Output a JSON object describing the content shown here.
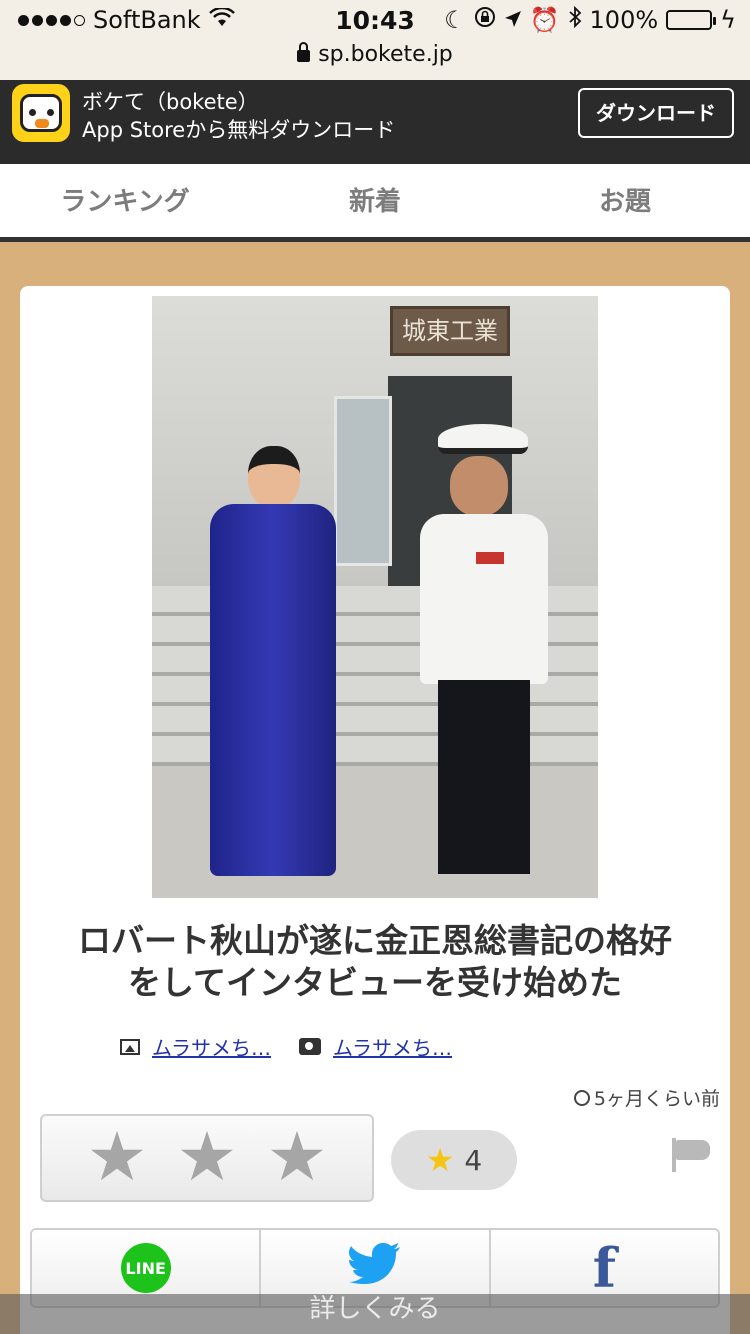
{
  "status_bar": {
    "carrier": "SoftBank",
    "time": "10:43",
    "battery": "100%"
  },
  "url_bar": {
    "domain": "sp.bokete.jp"
  },
  "app_banner": {
    "name": "ボケて（bokete）",
    "subtitle": "App Storeから無料ダウンロード",
    "download_label": "ダウンロード"
  },
  "tabs": [
    {
      "label": "ランキング"
    },
    {
      "label": "新着"
    },
    {
      "label": "お題"
    }
  ],
  "post": {
    "photo_sign_text": "城東工業",
    "caption_line1": "ロバート秋山が遂に金正恩総書記の格好",
    "caption_line2": "をしてインタビューを受け始めた",
    "credit_image": "ムラサメち…",
    "credit_photo": "ムラサメち…",
    "time_ago": "5ヶ月くらい前",
    "star_count": "4"
  },
  "share": {
    "line_label": "LINE",
    "twitter_icon": "twitter-bird-icon",
    "facebook_label": "f"
  },
  "more_label": "詳しくみる",
  "colors": {
    "banner_bg": "#2b2b2b",
    "wood_bg": "#d8b07c",
    "line_green": "#1dc31a",
    "twitter_blue": "#1da1f2",
    "facebook_blue": "#3b5998",
    "star_gold": "#f5c511"
  }
}
